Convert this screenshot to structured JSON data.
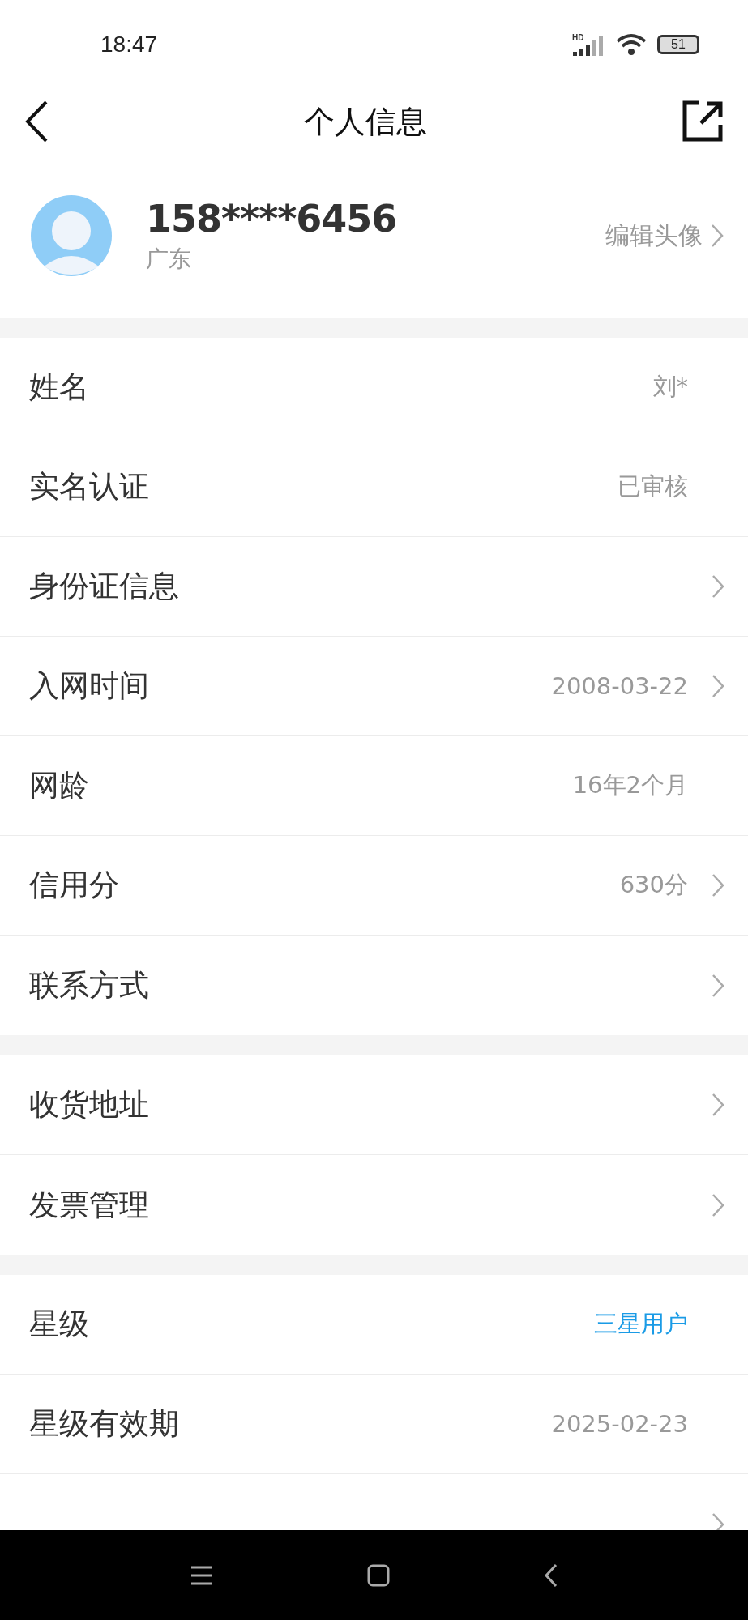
{
  "status_bar": {
    "time": "18:47",
    "network": "HD",
    "battery": "51"
  },
  "header": {
    "title": "个人信息"
  },
  "profile": {
    "phone": "158****6456",
    "region": "广东",
    "edit_label": "编辑头像"
  },
  "groups": [
    {
      "rows": [
        {
          "label": "姓名",
          "value": "刘*",
          "chevron": false,
          "highlight": false
        },
        {
          "label": "实名认证",
          "value": "已审核",
          "chevron": false,
          "highlight": false
        },
        {
          "label": "身份证信息",
          "chevron": true
        },
        {
          "label": "入网时间",
          "value": "2008-03-22",
          "chevron": true,
          "highlight": false
        },
        {
          "label": "网龄",
          "value": "16年2个月",
          "chevron": false,
          "highlight": false
        },
        {
          "label": "信用分",
          "value": "630分",
          "chevron": true,
          "highlight": false
        },
        {
          "label": "联系方式",
          "chevron": true
        }
      ]
    },
    {
      "rows": [
        {
          "label": "收货地址",
          "chevron": true
        },
        {
          "label": "发票管理",
          "chevron": true
        }
      ]
    },
    {
      "rows": [
        {
          "label": "星级",
          "value": "三星用户",
          "chevron": false,
          "highlight": true
        },
        {
          "label": "星级有效期",
          "value": "2025-02-23",
          "chevron": false,
          "highlight": false
        },
        {
          "chevron": true
        }
      ]
    }
  ]
}
